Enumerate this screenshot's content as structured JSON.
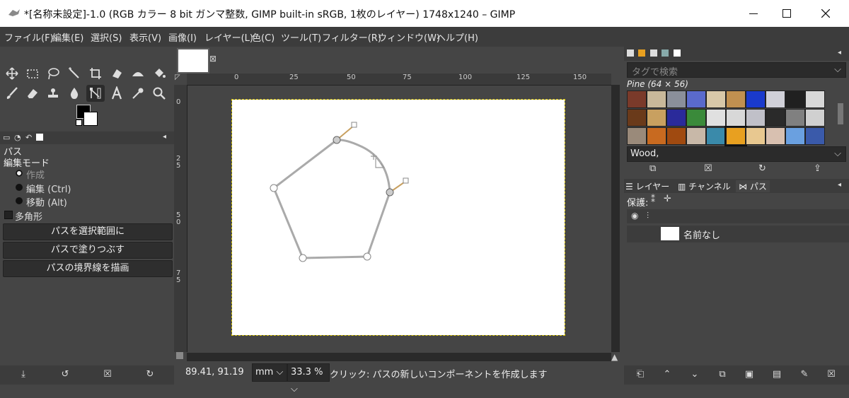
{
  "window": {
    "title": "*[名称未設定]-1.0 (RGB カラー 8 bit ガンマ整数, GIMP built-in sRGB, 1枚のレイヤー) 1748x1240 – GIMP"
  },
  "menubar": [
    "ファイル(F)",
    "編集(E)",
    "選択(S)",
    "表示(V)",
    "画像(I)",
    "レイヤー(L)",
    "色(C)",
    "ツール(T)",
    "フィルター(R)",
    "ウィンドウ(W)",
    "ヘルプ(H)"
  ],
  "tool_options": {
    "title": "パス",
    "edit_mode_label": "編集モード",
    "modes": [
      {
        "label": "作成",
        "selected": true
      },
      {
        "label": "編集 (Ctrl)",
        "selected": false
      },
      {
        "label": "移動 (Alt)",
        "selected": false
      }
    ],
    "polygon_label": "多角形",
    "buttons": [
      "パスを選択範囲に",
      "パスで塗りつぶす",
      "パスの境界線を描画"
    ]
  },
  "rulers": {
    "h_ticks": [
      "0",
      "25",
      "50",
      "75",
      "100",
      "125",
      "150"
    ],
    "v_ticks": [
      "0",
      "2\n5",
      "5\n0",
      "7\n5"
    ]
  },
  "status": {
    "coords": "89.41, 91.19",
    "unit": "mm",
    "zoom": "33.3 %",
    "message": "クリック: パスの新しいコンポーネントを作成します"
  },
  "patterns": {
    "search_placeholder": "タグで検索",
    "header": "Pine (64 × 56)",
    "tag_value": "Wood,",
    "colors": [
      "#7a3a2a",
      "#c8b89a",
      "#8a8f9a",
      "#5a6acc",
      "#d8c8a8",
      "#c09050",
      "#1a3acc",
      "#d0d0d8",
      "#202020",
      "#d8d8d8",
      "#6a3a1a",
      "#c8a060",
      "#2a2a9a",
      "#3a8a3a",
      "#e0e0e0",
      "#d8d8d8",
      "#c0c0c8",
      "#2a2a2a",
      "#808080",
      "#d0d0d0",
      "#9a8a7a",
      "#c86a20",
      "#a04a10",
      "#c8b8a8",
      "#3a8aaa",
      "#e8a020",
      "#e8c890",
      "#d8c0b0",
      "#6aa0e0",
      "#3a5aaa"
    ],
    "selected_index": 25
  },
  "layers_panel": {
    "tabs": [
      "レイヤー",
      "チャンネル",
      "パス"
    ],
    "lock_label": "保護:",
    "path_name": "名前なし"
  }
}
